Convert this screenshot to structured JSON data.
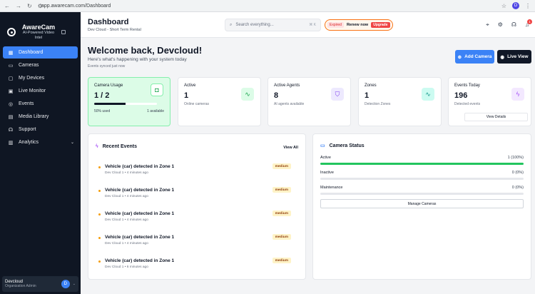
{
  "browser": {
    "url": "app.awarecam.com/Dashboard",
    "profile_initial": "D"
  },
  "sidebar": {
    "brand_name": "AwareCam",
    "brand_tagline": "AI-Powered Video Intel",
    "items": [
      {
        "label": "Dashboard",
        "icon": "grid-icon"
      },
      {
        "label": "Cameras",
        "icon": "video-icon"
      },
      {
        "label": "My Devices",
        "icon": "devices-icon"
      },
      {
        "label": "Live Monitor",
        "icon": "monitor-icon"
      },
      {
        "label": "Events",
        "icon": "alert-icon"
      },
      {
        "label": "Media Library",
        "icon": "folder-icon"
      },
      {
        "label": "Support",
        "icon": "headset-icon"
      },
      {
        "label": "Analytics",
        "icon": "chart-icon"
      }
    ],
    "user": {
      "name": "Devcloud",
      "role": "Organization Admin",
      "initial": "D"
    }
  },
  "header": {
    "title": "Dashboard",
    "subtitle": "Dev Cloud - Short Term Rental",
    "search_placeholder": "Search everything...",
    "search_shortcut": "⌘ K",
    "expired_badge": "Expired",
    "renew_text": "Renew now",
    "upgrade_label": "Upgrade",
    "notification_count": "1"
  },
  "welcome": {
    "title": "Welcome back, Devcloud!",
    "subtitle": "Here's what's happening with your system today",
    "synced": "Events synced just now",
    "add_camera": "Add Camera",
    "live_view": "Live View"
  },
  "stats": {
    "usage": {
      "label": "Camera Usage",
      "value": "1 / 2",
      "used": "50% used",
      "available": "1 available",
      "fraction": 0.5
    },
    "active": {
      "label": "Active",
      "value": "1",
      "desc": "Online cameras"
    },
    "agents": {
      "label": "Active Agents",
      "value": "8",
      "desc": "AI agents available"
    },
    "zones": {
      "label": "Zones",
      "value": "1",
      "desc": "Detection Zones"
    },
    "events": {
      "label": "Events Today",
      "value": "196",
      "desc": "Detected events",
      "button": "View Details"
    }
  },
  "recent_events": {
    "title": "Recent Events",
    "view_all": "View All",
    "items": [
      {
        "title": "Vehicle (car) detected in Zone 1",
        "meta": "Dev Cloud 1 • 4 minutes ago",
        "severity": "medium"
      },
      {
        "title": "Vehicle (car) detected in Zone 1",
        "meta": "Dev Cloud 1 • 4 minutes ago",
        "severity": "medium"
      },
      {
        "title": "Vehicle (car) detected in Zone 1",
        "meta": "Dev Cloud 1 • 4 minutes ago",
        "severity": "medium"
      },
      {
        "title": "Vehicle (car) detected in Zone 1",
        "meta": "Dev Cloud 1 • 4 minutes ago",
        "severity": "medium"
      },
      {
        "title": "Vehicle (car) detected in Zone 1",
        "meta": "Dev Cloud 1 • 6 minutes ago",
        "severity": "medium"
      }
    ]
  },
  "camera_status": {
    "title": "Camera Status",
    "rows": [
      {
        "label": "Active",
        "value": "1 (100%)",
        "fraction": 1.0
      },
      {
        "label": "Inactive",
        "value": "0 (0%)",
        "fraction": 0
      },
      {
        "label": "Maintenance",
        "value": "0 (0%)",
        "fraction": 0
      }
    ],
    "manage_button": "Manage Cameras"
  },
  "colors": {
    "accent": "#3b82f6",
    "sidebar_bg": "#0f1623",
    "success": "#22c55e",
    "warning": "#f59e0b",
    "danger": "#ef4444"
  }
}
